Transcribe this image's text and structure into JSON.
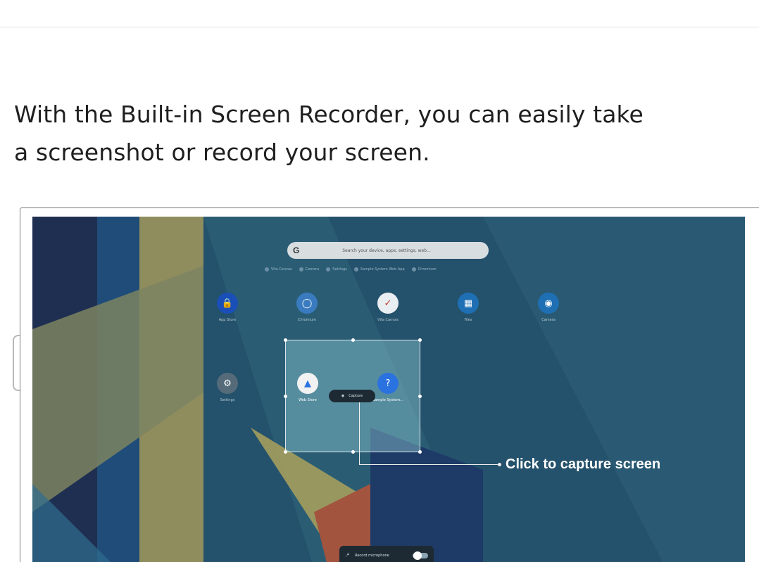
{
  "intro": {
    "line1": "With the Built-in Screen Recorder, you can easily take",
    "line2": "a screenshot or record your screen."
  },
  "launcher": {
    "search_icon": "google-g",
    "search_placeholder": "Search your device, apps, settings, web...",
    "chips": [
      {
        "icon": "vita-icon",
        "label": "Vita Canvas"
      },
      {
        "icon": "camera-icon",
        "label": "Camera"
      },
      {
        "icon": "gear-icon",
        "label": "Settings"
      },
      {
        "icon": "app-icon",
        "label": "Sample System Web App"
      },
      {
        "icon": "chromium-icon",
        "label": "Chromium"
      }
    ],
    "apps": [
      {
        "icon": "lock-icon",
        "label": "App Store",
        "color": "#1a4fb8"
      },
      {
        "icon": "chromium-icon",
        "label": "Chromium",
        "color": "#3a7bbf"
      },
      {
        "icon": "vita-icon",
        "label": "Vita Canvas",
        "color": "#e8eef2"
      },
      {
        "icon": "folder-icon",
        "label": "Files",
        "color": "#1e6fb3"
      },
      {
        "icon": "camera-icon",
        "label": "Camera",
        "color": "#1e6fb3"
      },
      {
        "icon": "gear-icon",
        "label": "Settings",
        "color": "#556b7a"
      },
      {
        "icon": "web-store-icon",
        "label": "Web Store",
        "color": "#f2f2f2"
      },
      {
        "icon": "help-icon",
        "label": "Sample System...",
        "color": "#2a72e0"
      }
    ]
  },
  "capture": {
    "button_label": "Capture",
    "callout": "Click to capture screen"
  },
  "mic_bar": {
    "label": "Record microphone",
    "toggle_on": true
  }
}
